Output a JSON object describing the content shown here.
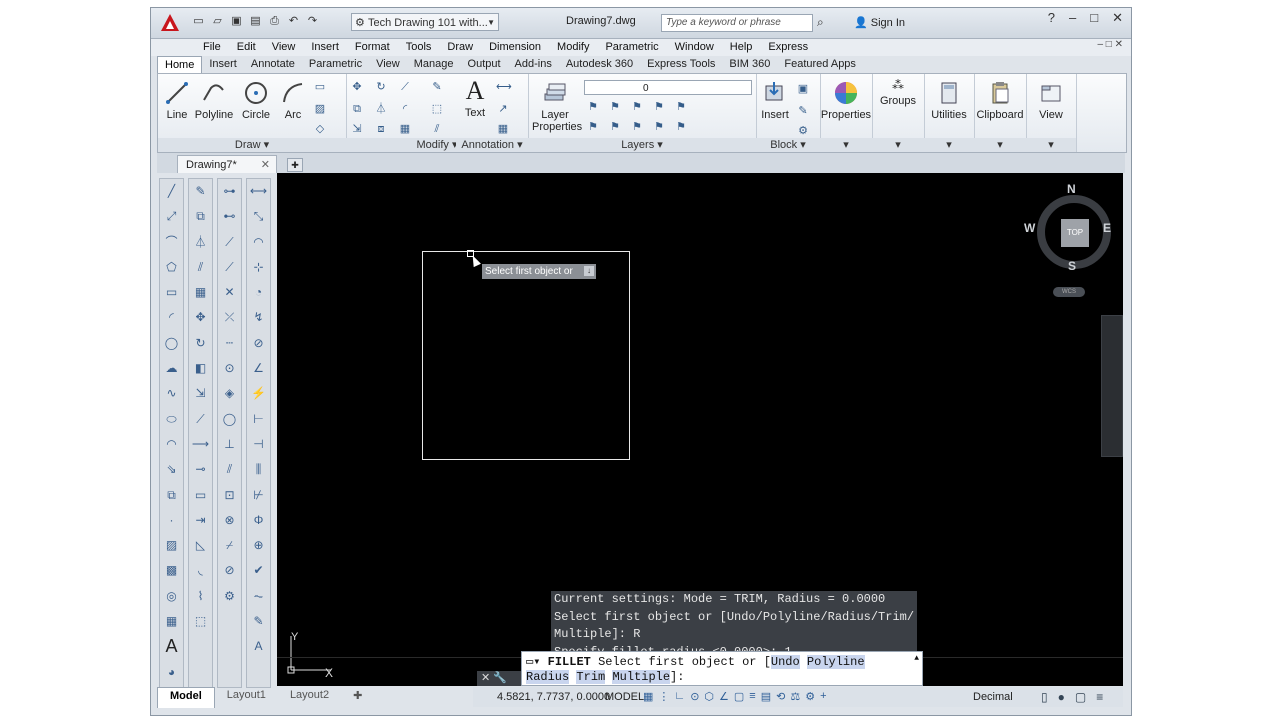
{
  "titlebar": {
    "workspace": "Tech Drawing 101 with...",
    "filename": "Drawing7.dwg",
    "search_placeholder": "Type a keyword or phrase",
    "signin": "Sign In"
  },
  "menubar": [
    "File",
    "Edit",
    "View",
    "Insert",
    "Format",
    "Tools",
    "Draw",
    "Dimension",
    "Modify",
    "Parametric",
    "Window",
    "Help",
    "Express"
  ],
  "ribbon_tabs": [
    "Home",
    "Insert",
    "Annotate",
    "Parametric",
    "View",
    "Manage",
    "Output",
    "Add-ins",
    "Autodesk 360",
    "Express Tools",
    "BIM 360",
    "Featured Apps"
  ],
  "ribbon": {
    "draw": {
      "label": "Draw",
      "line": "Line",
      "polyline": "Polyline",
      "circle": "Circle",
      "arc": "Arc"
    },
    "modify": {
      "label": "Modify"
    },
    "annotation": {
      "label": "Annotation",
      "text": "Text"
    },
    "layers": {
      "label": "Layers",
      "layer_properties_1": "Layer",
      "layer_properties_2": "Properties",
      "current_layer": "0"
    },
    "block": {
      "label": "Block",
      "insert": "Insert"
    },
    "properties": "Properties",
    "groups": "Groups",
    "utilities": "Utilities",
    "clipboard": "Clipboard",
    "view": "View"
  },
  "doc_tab": "Drawing7*",
  "canvas": {
    "tooltip": "Select first object or",
    "viewcube": {
      "n": "N",
      "s": "S",
      "e": "E",
      "w": "W",
      "top": "TOP",
      "wcs": "WCS"
    },
    "ucs_y": "Y",
    "ucs_x": "X"
  },
  "command": {
    "history": [
      "Current settings: Mode = TRIM, Radius = 0.0000",
      "Select first object or [Undo/Polyline/Radius/Trim/",
      "Multiple]: R",
      "Specify fillet radius <0.0000>: 1"
    ],
    "prompt_cmd": "FILLET",
    "prompt_text": " Select first object or [",
    "opt_undo": "Undo",
    "opt_polyline": "Polyline",
    "opt_radius": "Radius",
    "opt_trim": "Trim",
    "opt_multiple": "Multiple",
    "prompt_end": "]:"
  },
  "layout_tabs": [
    "Model",
    "Layout1",
    "Layout2"
  ],
  "status": {
    "coords": "4.5821, 7.7737, 0.0000",
    "model": "MODEL",
    "units": "Decimal"
  }
}
